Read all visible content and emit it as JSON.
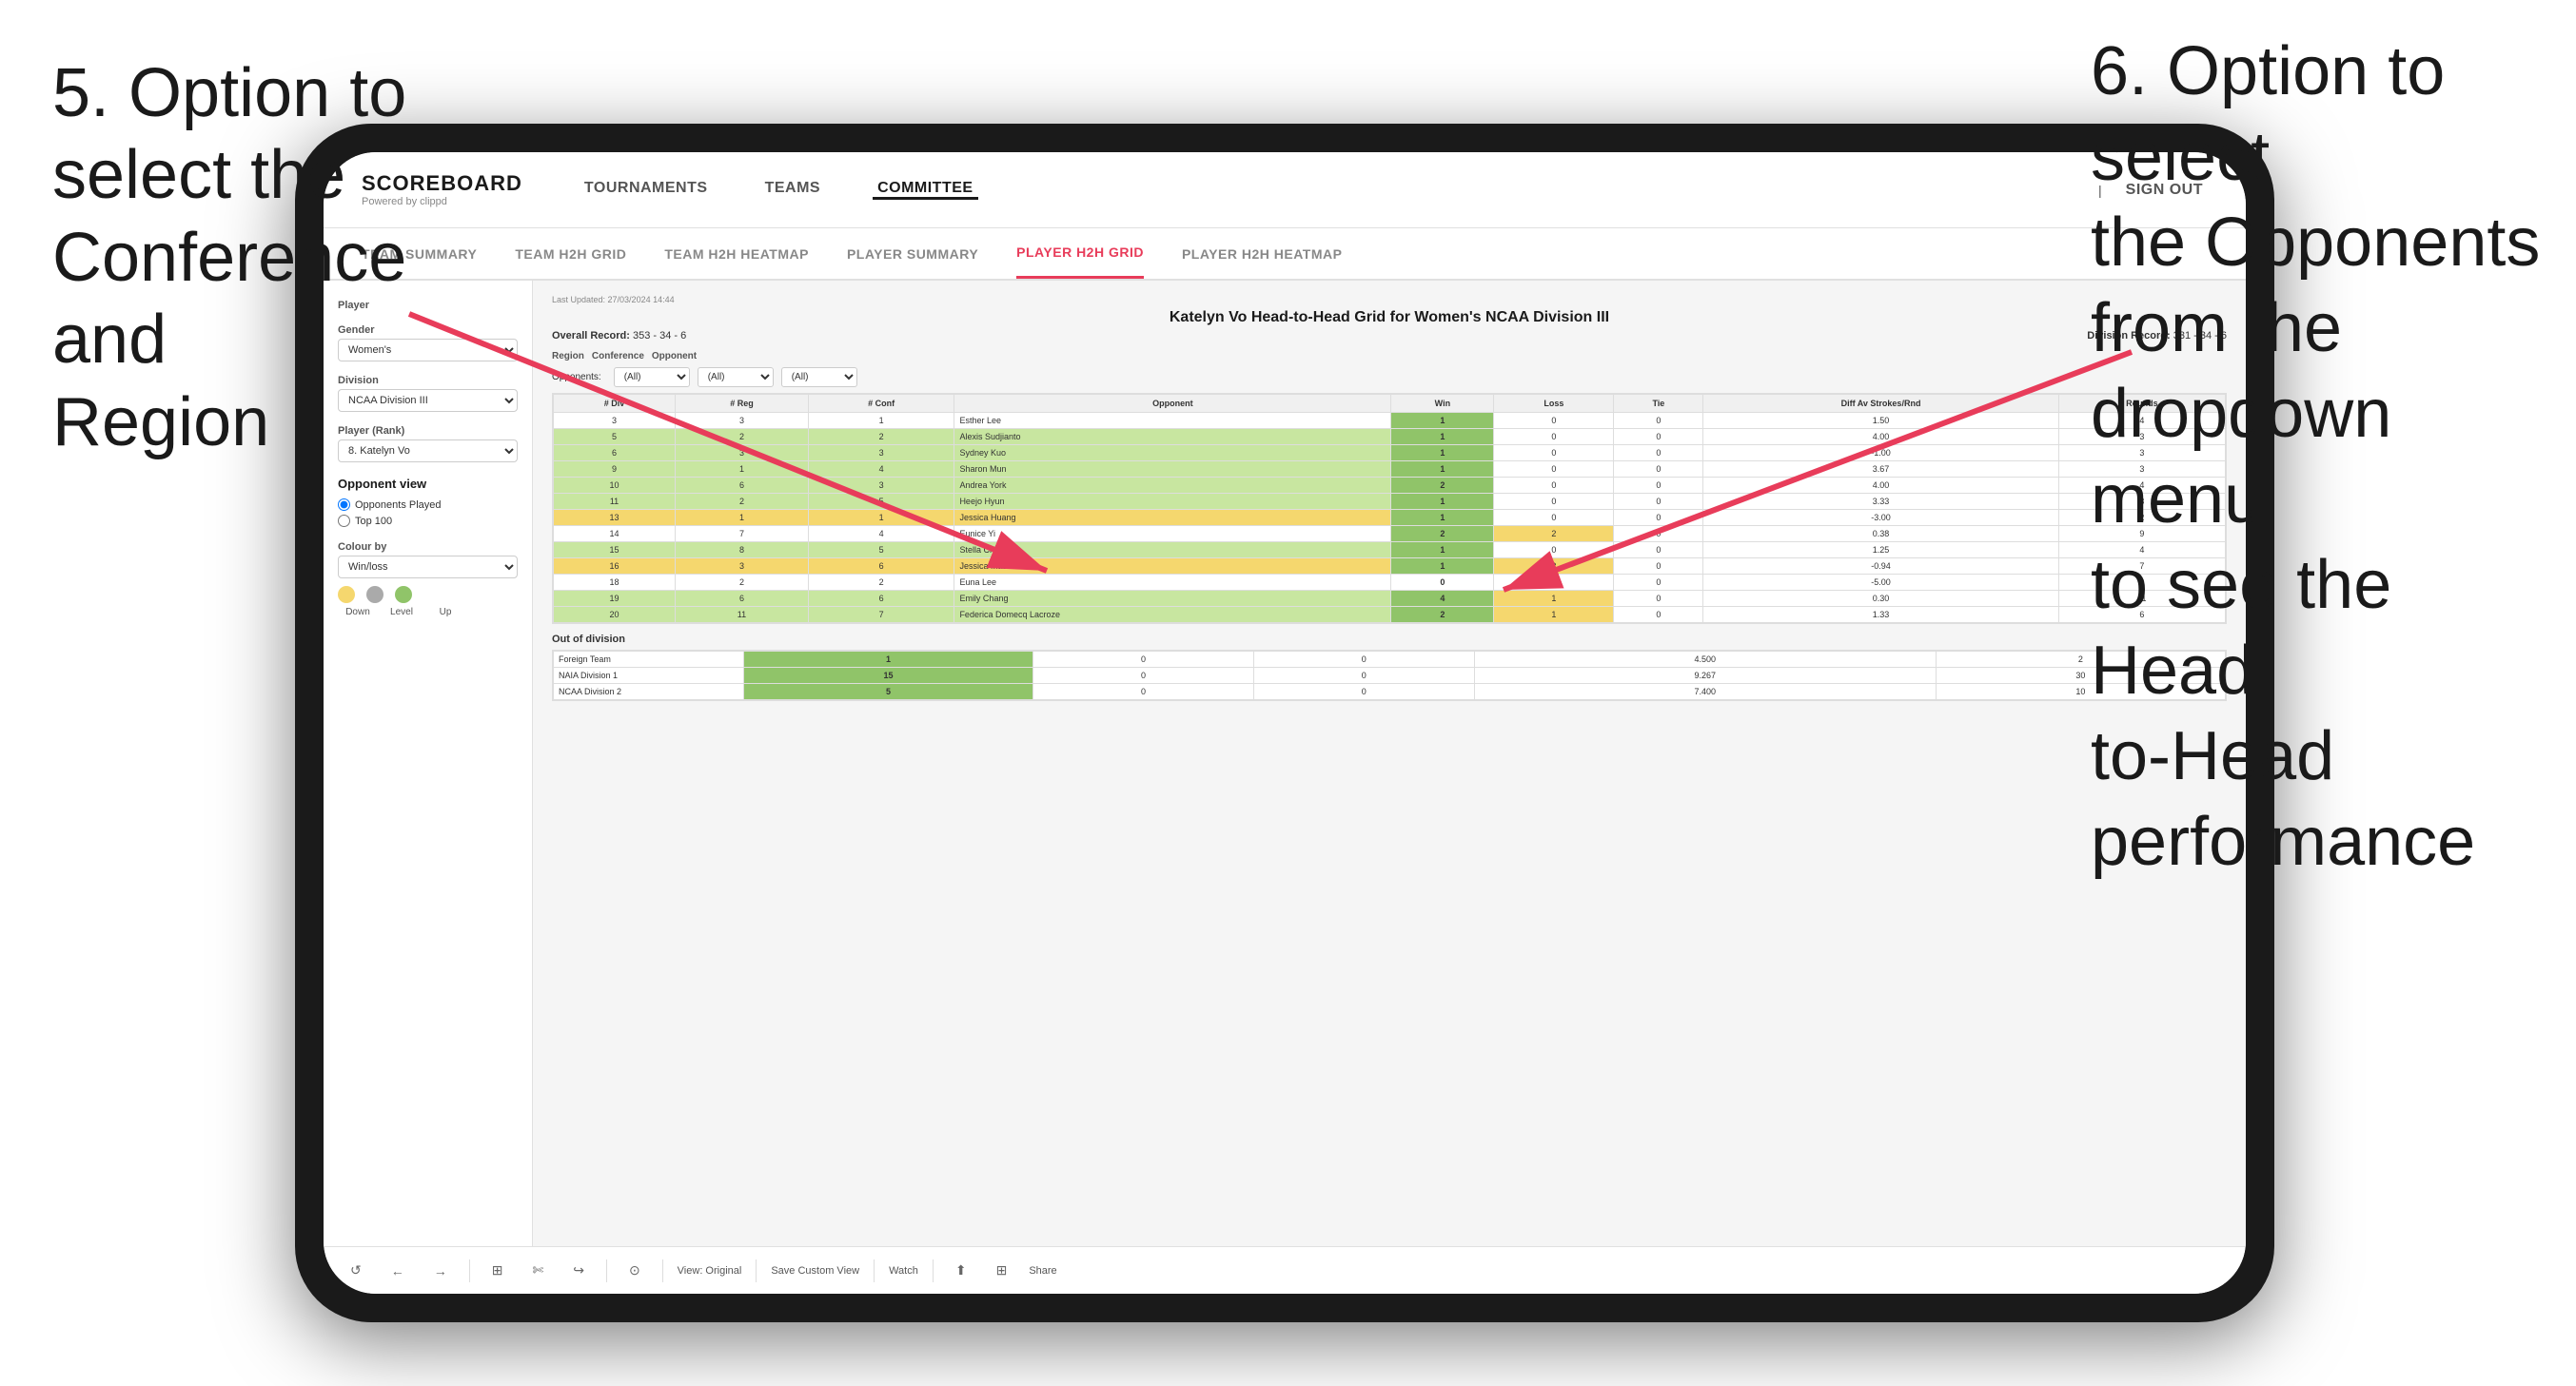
{
  "annotations": {
    "left": {
      "line1": "5. Option to",
      "line2": "select the",
      "line3": "Conference and",
      "line4": "Region"
    },
    "right": {
      "line1": "6. Option to select",
      "line2": "the Opponents",
      "line3": "from the",
      "line4": "dropdown menu",
      "line5": "to see the Head-",
      "line6": "to-Head",
      "line7": "performance"
    }
  },
  "nav": {
    "logo": "SCOREBOARD",
    "logo_sub": "Powered by clippd",
    "items": [
      "TOURNAMENTS",
      "TEAMS",
      "COMMITTEE"
    ],
    "active_item": "COMMITTEE",
    "sign_out": "Sign out"
  },
  "sub_nav": {
    "items": [
      "TEAM SUMMARY",
      "TEAM H2H GRID",
      "TEAM H2H HEATMAP",
      "PLAYER SUMMARY",
      "PLAYER H2H GRID",
      "PLAYER H2H HEATMAP"
    ],
    "active_item": "PLAYER H2H GRID"
  },
  "sidebar": {
    "player_label": "Player",
    "gender_label": "Gender",
    "gender_value": "Women's",
    "division_label": "Division",
    "division_value": "NCAA Division III",
    "player_rank_label": "Player (Rank)",
    "player_rank_value": "8. Katelyn Vo",
    "opponent_view_label": "Opponent view",
    "opponent_played": "Opponents Played",
    "top_100": "Top 100",
    "colour_by_label": "Colour by",
    "colour_by_value": "Win/loss",
    "colour_labels": [
      "Down",
      "Level",
      "Up"
    ],
    "colours": [
      "#f5d76e",
      "#aaaaaa",
      "#90c469"
    ]
  },
  "report": {
    "last_updated": "Last Updated: 27/03/2024 14:44",
    "title": "Katelyn Vo Head-to-Head Grid for Women's NCAA Division III",
    "overall_record_label": "Overall Record:",
    "overall_record": "353 - 34 - 6",
    "division_record_label": "Division Record:",
    "division_record": "331 - 34 - 6",
    "filter_region_label": "Region",
    "filter_conference_label": "Conference",
    "filter_opponent_label": "Opponent",
    "opponents_label": "Opponents:",
    "opponents_value": "(All)",
    "conference_value": "(All)",
    "opponent_value": "(All)",
    "columns": [
      "# Div",
      "# Reg",
      "# Conf",
      "Opponent",
      "Win",
      "Loss",
      "Tie",
      "Diff Av Strokes/Rnd",
      "Rounds"
    ],
    "rows": [
      {
        "div": 3,
        "reg": 3,
        "conf": 1,
        "opponent": "Esther Lee",
        "win": 1,
        "loss": 0,
        "tie": 0,
        "diff": "1.50",
        "rounds": 4,
        "color": "white"
      },
      {
        "div": 5,
        "reg": 2,
        "conf": 2,
        "opponent": "Alexis Sudjianto",
        "win": 1,
        "loss": 0,
        "tie": 0,
        "diff": "4.00",
        "rounds": 3,
        "color": "green"
      },
      {
        "div": 6,
        "reg": 3,
        "conf": 3,
        "opponent": "Sydney Kuo",
        "win": 1,
        "loss": 0,
        "tie": 0,
        "diff": "-1.00",
        "rounds": 3,
        "color": "green"
      },
      {
        "div": 9,
        "reg": 1,
        "conf": 4,
        "opponent": "Sharon Mun",
        "win": 1,
        "loss": 0,
        "tie": 0,
        "diff": "3.67",
        "rounds": 3,
        "color": "green"
      },
      {
        "div": 10,
        "reg": 6,
        "conf": 3,
        "opponent": "Andrea York",
        "win": 2,
        "loss": 0,
        "tie": 0,
        "diff": "4.00",
        "rounds": 4,
        "color": "green"
      },
      {
        "div": 11,
        "reg": 2,
        "conf": 5,
        "opponent": "Heejo Hyun",
        "win": 1,
        "loss": 0,
        "tie": 0,
        "diff": "3.33",
        "rounds": 3,
        "color": "green"
      },
      {
        "div": 13,
        "reg": 1,
        "conf": 1,
        "opponent": "Jessica Huang",
        "win": 1,
        "loss": 0,
        "tie": 0,
        "diff": "-3.00",
        "rounds": 2,
        "color": "yellow"
      },
      {
        "div": 14,
        "reg": 7,
        "conf": 4,
        "opponent": "Eunice Yi",
        "win": 2,
        "loss": 2,
        "tie": 0,
        "diff": "0.38",
        "rounds": 9,
        "color": "white"
      },
      {
        "div": 15,
        "reg": 8,
        "conf": 5,
        "opponent": "Stella Cheng",
        "win": 1,
        "loss": 0,
        "tie": 0,
        "diff": "1.25",
        "rounds": 4,
        "color": "green"
      },
      {
        "div": 16,
        "reg": 3,
        "conf": 6,
        "opponent": "Jessica Mason",
        "win": 1,
        "loss": 2,
        "tie": 0,
        "diff": "-0.94",
        "rounds": 7,
        "color": "yellow"
      },
      {
        "div": 18,
        "reg": 2,
        "conf": 2,
        "opponent": "Euna Lee",
        "win": 0,
        "loss": 0,
        "tie": 0,
        "diff": "-5.00",
        "rounds": 2,
        "color": "white"
      },
      {
        "div": 19,
        "reg": 6,
        "conf": 6,
        "opponent": "Emily Chang",
        "win": 4,
        "loss": 1,
        "tie": 0,
        "diff": "0.30",
        "rounds": 11,
        "color": "green"
      },
      {
        "div": 20,
        "reg": 11,
        "conf": 7,
        "opponent": "Federica Domecq Lacroze",
        "win": 2,
        "loss": 1,
        "tie": 0,
        "diff": "1.33",
        "rounds": 6,
        "color": "green"
      }
    ],
    "out_of_division": {
      "label": "Out of division",
      "rows": [
        {
          "opponent": "Foreign Team",
          "win": 1,
          "loss": 0,
          "tie": 0,
          "diff": "4.500",
          "rounds": 2,
          "color": "green"
        },
        {
          "opponent": "NAIA Division 1",
          "win": 15,
          "loss": 0,
          "tie": 0,
          "diff": "9.267",
          "rounds": 30,
          "color": "green"
        },
        {
          "opponent": "NCAA Division 2",
          "win": 5,
          "loss": 0,
          "tie": 0,
          "diff": "7.400",
          "rounds": 10,
          "color": "green"
        }
      ]
    }
  },
  "toolbar": {
    "buttons": [
      "↺",
      "←",
      "→",
      "⊞",
      "✄",
      "↪",
      "⊙"
    ],
    "view_original": "View: Original",
    "save_custom_view": "Save Custom View",
    "watch": "Watch",
    "share": "Share"
  }
}
